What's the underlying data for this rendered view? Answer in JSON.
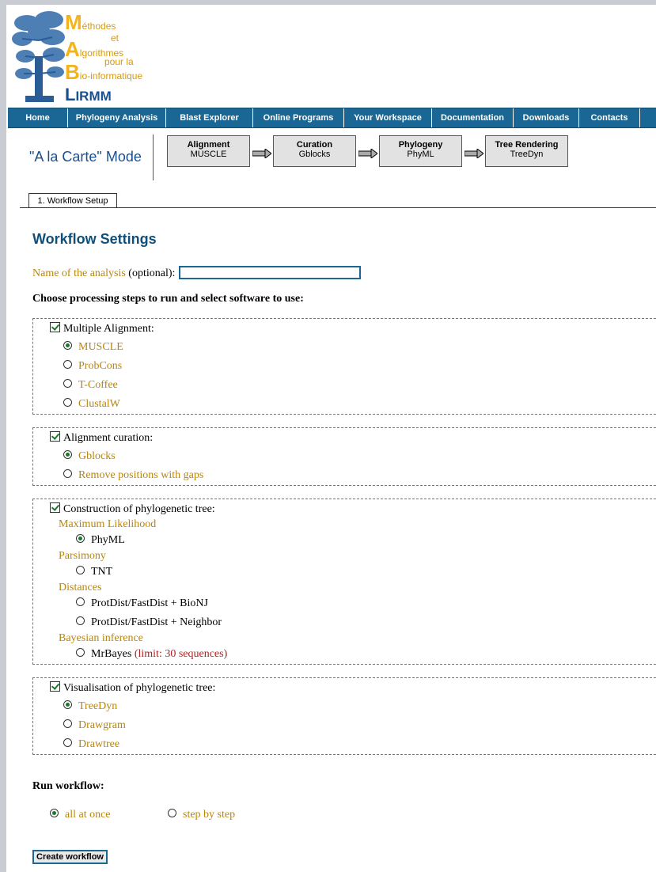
{
  "logo": {
    "line1": "M",
    "line1_rest": "éthodes",
    "line2": "et",
    "line3": "A",
    "line3_rest": "lgorithmes",
    "line4": "pour la",
    "line5": "B",
    "line5_rest": "io-informatique",
    "line6": "L",
    "line6_rest": "IRMM"
  },
  "nav": [
    "Home",
    "Phylogeny Analysis",
    "Blast Explorer",
    "Online Programs",
    "Your Workspace",
    "Documentation",
    "Downloads",
    "Contacts"
  ],
  "mode": {
    "title": "\"A la Carte\" Mode",
    "steps": [
      {
        "name": "Alignment",
        "tool": "MUSCLE"
      },
      {
        "name": "Curation",
        "tool": "Gblocks"
      },
      {
        "name": "Phylogeny",
        "tool": "PhyML"
      },
      {
        "name": "Tree Rendering",
        "tool": "TreeDyn"
      }
    ]
  },
  "tab": "1. Workflow Setup",
  "heading": "Workflow Settings",
  "analysis_name": {
    "label": "Name of the analysis",
    "suffix": "(optional):",
    "value": ""
  },
  "choose_label": "Choose processing steps to run and select software to use:",
  "alignment": {
    "label": "Multiple Alignment:",
    "options": [
      "MUSCLE",
      "ProbCons",
      "T-Coffee",
      "ClustalW"
    ],
    "selected": "MUSCLE"
  },
  "curation": {
    "label": "Alignment curation:",
    "options": [
      "Gblocks",
      "Remove positions with gaps"
    ],
    "selected": "Gblocks"
  },
  "phylogeny": {
    "label": "Construction of phylogenetic tree:",
    "ml_label": "Maximum Likelihood",
    "ml_option": "PhyML",
    "parsimony_label": "Parsimony",
    "parsimony_option": "TNT",
    "distances_label": "Distances",
    "dist_option1": "ProtDist/FastDist + BioNJ",
    "dist_option2": "ProtDist/FastDist + Neighbor",
    "bayes_label": "Bayesian inference",
    "bayes_option": "MrBayes",
    "bayes_limit": "(limit: 30 sequences)"
  },
  "visualisation": {
    "label": "Visualisation of phylogenetic tree:",
    "options": [
      "TreeDyn",
      "Drawgram",
      "Drawtree"
    ],
    "selected": "TreeDyn"
  },
  "run": {
    "label": "Run workflow:",
    "option1": "all at once",
    "option2": "step by step"
  },
  "create_button": "Create workflow"
}
